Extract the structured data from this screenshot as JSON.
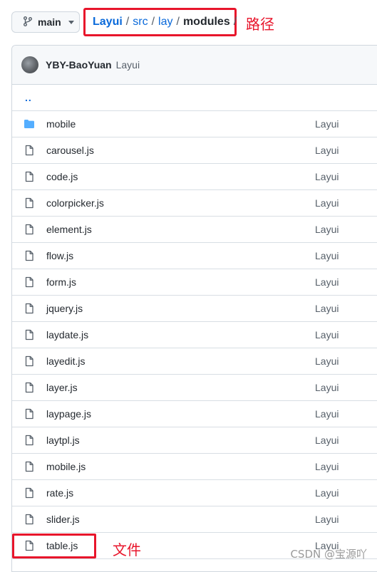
{
  "branch": {
    "label": "main",
    "icon": "git-branch-icon"
  },
  "breadcrumb": {
    "root": "Layui",
    "parts": [
      "src",
      "lay"
    ],
    "current": "modules",
    "separator": "/"
  },
  "annotations": {
    "path_label": "路径",
    "file_label": "文件",
    "highlight_color": "#e8152b"
  },
  "commit": {
    "author": "YBY-BaoYuan",
    "message": "Layui"
  },
  "parent_dir": "..",
  "files": [
    {
      "name": "mobile",
      "type": "folder",
      "message": "Layui"
    },
    {
      "name": "carousel.js",
      "type": "file",
      "message": "Layui"
    },
    {
      "name": "code.js",
      "type": "file",
      "message": "Layui"
    },
    {
      "name": "colorpicker.js",
      "type": "file",
      "message": "Layui"
    },
    {
      "name": "element.js",
      "type": "file",
      "message": "Layui"
    },
    {
      "name": "flow.js",
      "type": "file",
      "message": "Layui"
    },
    {
      "name": "form.js",
      "type": "file",
      "message": "Layui"
    },
    {
      "name": "jquery.js",
      "type": "file",
      "message": "Layui"
    },
    {
      "name": "laydate.js",
      "type": "file",
      "message": "Layui"
    },
    {
      "name": "layedit.js",
      "type": "file",
      "message": "Layui"
    },
    {
      "name": "layer.js",
      "type": "file",
      "message": "Layui"
    },
    {
      "name": "laypage.js",
      "type": "file",
      "message": "Layui"
    },
    {
      "name": "laytpl.js",
      "type": "file",
      "message": "Layui"
    },
    {
      "name": "mobile.js",
      "type": "file",
      "message": "Layui"
    },
    {
      "name": "rate.js",
      "type": "file",
      "message": "Layui"
    },
    {
      "name": "slider.js",
      "type": "file",
      "message": "Layui"
    },
    {
      "name": "table.js",
      "type": "file",
      "message": "Layui"
    }
  ],
  "watermark": "CSDN @宝源吖",
  "colors": {
    "link": "#0969da",
    "folder": "#54aeff",
    "border": "#d0d7de"
  }
}
